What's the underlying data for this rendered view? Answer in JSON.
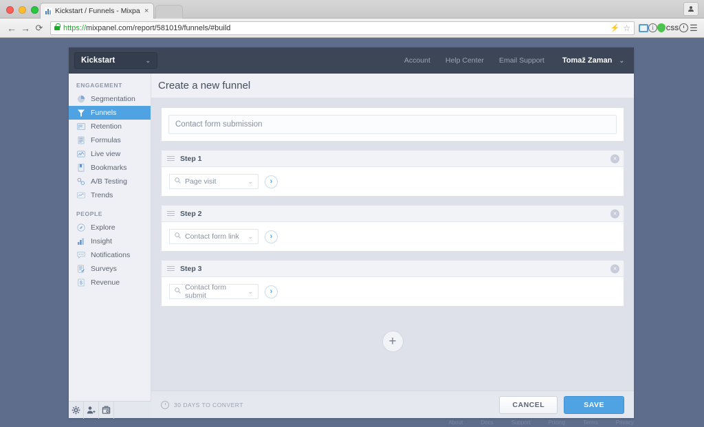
{
  "browser": {
    "tab_title": "Kickstart / Funnels - Mixpa",
    "tab_close": "×",
    "back": "←",
    "forward": "→",
    "reload": "⟳",
    "url_scheme": "https://",
    "url_rest": "mixpanel.com/report/581019/funnels/#build",
    "bolt": "⚡",
    "star": "☆",
    "ext_css_label": "CSS",
    "ext_info_label": "i",
    "menu": "☰",
    "profile": "♟"
  },
  "header": {
    "project": "Kickstart",
    "project_chevron": "⌄",
    "links": [
      "Account",
      "Help Center",
      "Email Support"
    ],
    "user": "Tomaž Zaman",
    "user_chevron": "⌄"
  },
  "sidebar": {
    "sections": [
      {
        "label": "ENGAGEMENT",
        "items": [
          {
            "label": "Segmentation",
            "icon": "pie-chart-icon",
            "active": false
          },
          {
            "label": "Funnels",
            "icon": "funnel-icon",
            "active": true
          },
          {
            "label": "Retention",
            "icon": "grid-icon",
            "active": false
          },
          {
            "label": "Formulas",
            "icon": "formula-icon",
            "active": false
          },
          {
            "label": "Live view",
            "icon": "live-view-icon",
            "active": false
          },
          {
            "label": "Bookmarks",
            "icon": "bookmark-icon",
            "active": false
          },
          {
            "label": "A/B Testing",
            "icon": "ab-testing-icon",
            "active": false
          },
          {
            "label": "Trends",
            "icon": "trends-icon",
            "active": false
          }
        ]
      },
      {
        "label": "PEOPLE",
        "items": [
          {
            "label": "Explore",
            "icon": "explore-icon",
            "active": false
          },
          {
            "label": "Insight",
            "icon": "insight-icon",
            "active": false
          },
          {
            "label": "Notifications",
            "icon": "notifications-icon",
            "active": false
          },
          {
            "label": "Surveys",
            "icon": "surveys-icon",
            "active": false
          },
          {
            "label": "Revenue",
            "icon": "revenue-icon",
            "active": false
          }
        ]
      }
    ],
    "footer_icons": [
      "gear-icon",
      "add-user-icon",
      "data-archive-icon"
    ]
  },
  "main": {
    "title": "Create a new funnel",
    "funnel_name_value": "Contact form submission",
    "funnel_name_placeholder": "Contact form submission",
    "steps": [
      {
        "label": "Step 1",
        "event": "Page visit",
        "close": "×",
        "chevron": "⌄",
        "go": "›"
      },
      {
        "label": "Step 2",
        "event": "Contact form link",
        "close": "×",
        "chevron": "⌄",
        "go": "›"
      },
      {
        "label": "Step 3",
        "event": "Contact form submit",
        "close": "×",
        "chevron": "⌄",
        "go": "›"
      }
    ],
    "add_step": "+",
    "convert_window": "30 DAYS TO CONVERT",
    "cancel_label": "CANCEL",
    "save_label": "SAVE"
  },
  "page_footer": {
    "links": [
      "About",
      "Docs",
      "Support",
      "Pricing",
      "Terms",
      "Privacy"
    ]
  },
  "colors": {
    "accent_blue": "#4fa3e3",
    "header_navy": "#3c4657",
    "page_slate": "#5e6d8c",
    "sidebar_bg": "#eef0f5",
    "content_bg": "#dfe1ea"
  }
}
